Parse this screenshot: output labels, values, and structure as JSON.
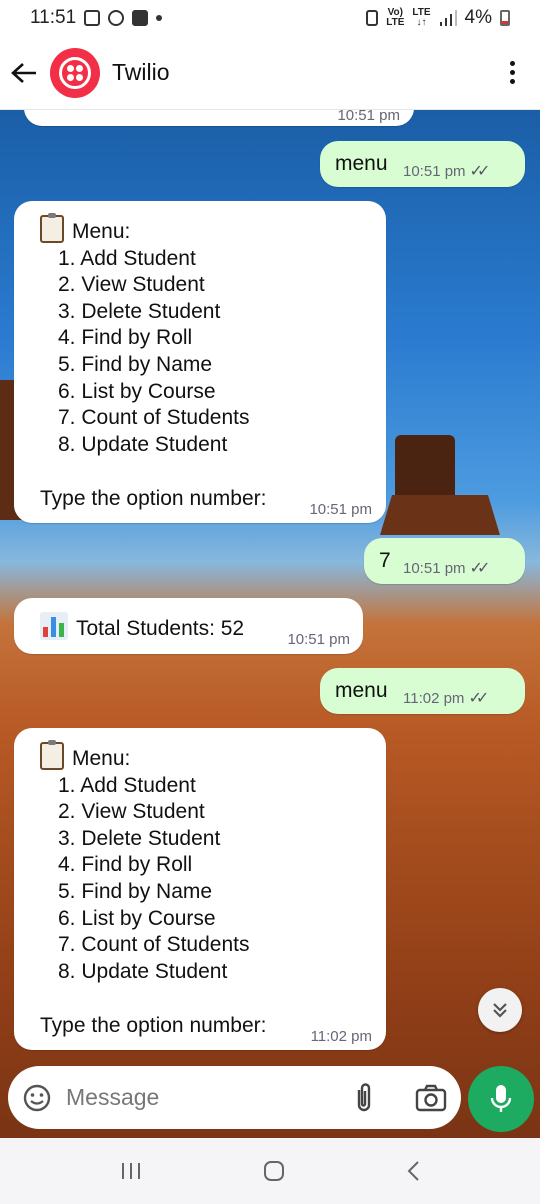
{
  "status_bar": {
    "time": "11:51",
    "signal_label": "Vo) LTE",
    "lte_label": "LTE",
    "battery": "4%"
  },
  "header": {
    "contact_name": "Twilio"
  },
  "messages": [
    {
      "dir": "in",
      "partial": true,
      "time": "10:51 pm"
    },
    {
      "dir": "out",
      "text": "menu",
      "time": "10:51 pm"
    },
    {
      "dir": "in",
      "title": "Menu:",
      "items": [
        "1. Add Student",
        "2. View Student",
        "3. Delete Student",
        "4. Find by Roll",
        "5. Find by Name",
        "6. List by Course",
        "7. Count of Students",
        "8. Update Student"
      ],
      "footer": "Type the option number:",
      "time": "10:51 pm"
    },
    {
      "dir": "out",
      "text": "7",
      "time": "10:51 pm"
    },
    {
      "dir": "in",
      "text": "Total Students: 52",
      "time": "10:51 pm"
    },
    {
      "dir": "out",
      "text": "menu",
      "time": "11:02 pm"
    },
    {
      "dir": "in",
      "title": "Menu:",
      "items": [
        "1. Add Student",
        "2. View Student",
        "3. Delete Student",
        "4. Find by Roll",
        "5. Find by Name",
        "6. List by Course",
        "7. Count of Students",
        "8. Update Student"
      ],
      "footer": "Type the option number:",
      "time": "11:02 pm"
    }
  ],
  "composer": {
    "placeholder": "Message"
  },
  "icons": {
    "back": "arrow-left-icon",
    "more": "more-vert-icon",
    "emoji": "sticker-icon",
    "attach": "paperclip-icon",
    "camera": "camera-icon",
    "mic": "mic-icon",
    "scroll": "chevron-double-down-icon"
  },
  "colors": {
    "outgoing_bubble": "#d9fdd3",
    "incoming_bubble": "#ffffff",
    "mic_button": "#1daa61",
    "twilio_red": "#f22f46"
  }
}
